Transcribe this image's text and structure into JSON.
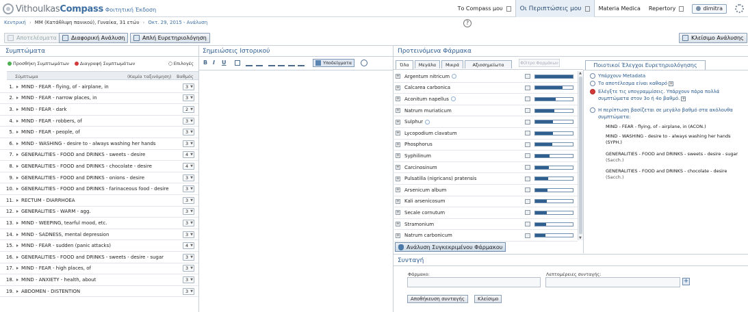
{
  "brand": {
    "name_light": "Vithoulkas",
    "name_bold": "Compass",
    "edition": "Φοιτητική Έκδοση"
  },
  "topnav": {
    "items": [
      {
        "label": "Το Compass μου",
        "active": false,
        "ext": true
      },
      {
        "label": "Οι Περιπτώσεις μου",
        "active": true,
        "ext": true
      },
      {
        "label": "Materia Medica",
        "active": false,
        "ext": false
      },
      {
        "label": "Repertory",
        "active": false,
        "ext": true
      }
    ],
    "user": "dimitra"
  },
  "breadcrumb": {
    "home": "Κεντρική",
    "case": "ΜΜ (Κατάθλιψη πανικού), Γυναίκα, 31 ετών",
    "date": "Οκτ. 29, 2015 - Ανάλυση"
  },
  "help_glyph": "?",
  "toolbar": {
    "results": "Αποτελέσματα",
    "differential": "Διαφορική Ανάλυση",
    "simple": "Απλή Ευρετηριολόγηση",
    "close": "Κλείσιμο Ανάλυσης"
  },
  "symptoms": {
    "title": "Συμπτώματα",
    "add": "Προσθήκη Συμπτωμάτων",
    "delete": "Διαγραφή Συμπτωμάτων",
    "options": "Επιλογές",
    "col_symptom": "Σύμπτωμα",
    "col_sort": "(Καμία ταξινόμηση)",
    "col_grade": "Βαθμός",
    "rows": [
      {
        "n": "1.",
        "text": "MIND - FEAR - flying, of - airplane, in",
        "g": "3"
      },
      {
        "n": "2.",
        "text": "MIND - FEAR - narrow places, in",
        "g": "3"
      },
      {
        "n": "3.",
        "text": "MIND - FEAR - dark",
        "g": "2"
      },
      {
        "n": "4.",
        "text": "MIND - FEAR - robbers, of",
        "g": "3"
      },
      {
        "n": "5.",
        "text": "MIND - FEAR - people, of",
        "g": "3"
      },
      {
        "n": "6.",
        "text": "MIND - WASHING - desire to - always washing her hands",
        "g": "3"
      },
      {
        "n": "7.",
        "text": "GENERALITIES - FOOD and DRINKS - sweets - desire",
        "g": "4"
      },
      {
        "n": "8.",
        "text": "GENERALITIES - FOOD and DRINKS - chocolate - desire",
        "g": "4"
      },
      {
        "n": "9.",
        "text": "GENERALITIES - FOOD and DRINKS - onions - desire",
        "g": "3"
      },
      {
        "n": "10.",
        "text": "GENERALITIES - FOOD and DRINKS - farinaceous food - desire",
        "g": "3"
      },
      {
        "n": "11.",
        "text": "RECTUM - DIARRHOEA",
        "g": "3"
      },
      {
        "n": "12.",
        "text": "GENERALITIES - WARM - agg.",
        "g": "3"
      },
      {
        "n": "13.",
        "text": "MIND - WEEPING, tearful mood, etc.",
        "g": "3"
      },
      {
        "n": "14.",
        "text": "MIND - SADNESS, mental depression",
        "g": "3"
      },
      {
        "n": "15.",
        "text": "MIND - FEAR - sudden (panic attacks)",
        "g": "4"
      },
      {
        "n": "16.",
        "text": "GENERALITIES - FOOD and DRINKS - sweets - desire - sugar",
        "g": "3"
      },
      {
        "n": "17.",
        "text": "MIND - FEAR - high places, of",
        "g": "3"
      },
      {
        "n": "18.",
        "text": "MIND - ANXIETY - health, about",
        "g": "3"
      },
      {
        "n": "19.",
        "text": "ABDOMEN - DISTENTION",
        "g": "3"
      }
    ]
  },
  "history": {
    "title": "Σημειώσεις Ιστορικού",
    "tools": {
      "b": "B",
      "i": "I",
      "u": "U"
    },
    "examples": "Υποδείγματα"
  },
  "remedies": {
    "title": "Προτεινόμενα Φάρμακα",
    "tabs": [
      "Όλα",
      "Μεγάλα",
      "Μικρά",
      "Αξιοσημείωτα"
    ],
    "filter": "Φίλτρο Φαρμάκων",
    "rows": [
      {
        "name": "Argentum nitricum",
        "globe": true,
        "score": 1.0
      },
      {
        "name": "Calcarea carbonica",
        "globe": false,
        "score": 0.72
      },
      {
        "name": "Aconitum napellus",
        "globe": true,
        "score": 0.55
      },
      {
        "name": "Natrum muriaticum",
        "globe": false,
        "score": 0.5
      },
      {
        "name": "Sulphur",
        "globe": true,
        "score": 0.48
      },
      {
        "name": "Lycopodium clavatum",
        "globe": false,
        "score": 0.47
      },
      {
        "name": "Phosphorus",
        "globe": false,
        "score": 0.45
      },
      {
        "name": "Syphilinum",
        "globe": false,
        "score": 0.38
      },
      {
        "name": "Carcinosinum",
        "globe": false,
        "score": 0.36
      },
      {
        "name": "Pulsatilla (nigricans) pratensis",
        "globe": false,
        "score": 0.34
      },
      {
        "name": "Arsenicum album",
        "globe": false,
        "score": 0.32
      },
      {
        "name": "Kali arsenicosum",
        "globe": false,
        "score": 0.31
      },
      {
        "name": "Secale cornutum",
        "globe": false,
        "score": 0.3
      },
      {
        "name": "Stramonium",
        "globe": false,
        "score": 0.29
      },
      {
        "name": "Natrum carbonicum",
        "globe": false,
        "score": 0.28
      }
    ],
    "analysis_btn": "Ανάλυση Συγκεκριμένου Φάρμακου"
  },
  "quality": {
    "tab": "Ποιοτικοί Έλεγχοι Ευρετηριολόγησης",
    "lines": [
      {
        "text": "Υπάρχουν Metadata",
        "red": false,
        "plus": false
      },
      {
        "text": "Το αποτέλεσμα είναι καθαρό",
        "red": false,
        "plus": true
      },
      {
        "text": "Ελέγξτε τις υπογραμμίσεις. Υπάρχουν πάρα πολλά συμπτώματα στον 3ο ή 4ο βαθμό.",
        "red": true,
        "plus": true
      },
      {
        "text": "Η περίπτωση βασίζεται σε μεγάλο βαθμό στα ακόλουθα συμπτώματα:",
        "red": false,
        "plus": false
      }
    ],
    "symptoms": [
      {
        "text": "MIND - FEAR - flying, of - airplane, in (ACON.)",
        "g": ""
      },
      {
        "text": "MIND - WASHING - desire to - always washing her hands (SYPH.)",
        "g": ""
      },
      {
        "text": "GENERALITIES - FOOD and DRINKS - sweets - desire - sugar",
        "g": "(Sacch.)"
      },
      {
        "text": "GENERALITIES - FOOD and DRINKS - chocolate - desire",
        "g": "(Sacch.)"
      }
    ]
  },
  "prescription": {
    "title": "Συνταγή",
    "remedy_label": "Φάρμακο:",
    "details_label": "Λεπτομέρειες συνταγής:",
    "add": "+",
    "save": "Αποθήκευση συνταγής",
    "close": "Κλείσιμο"
  },
  "colors": {
    "accent": "#2c5c8f",
    "bar": "#2f5f8f",
    "red": "#d23a3a"
  }
}
